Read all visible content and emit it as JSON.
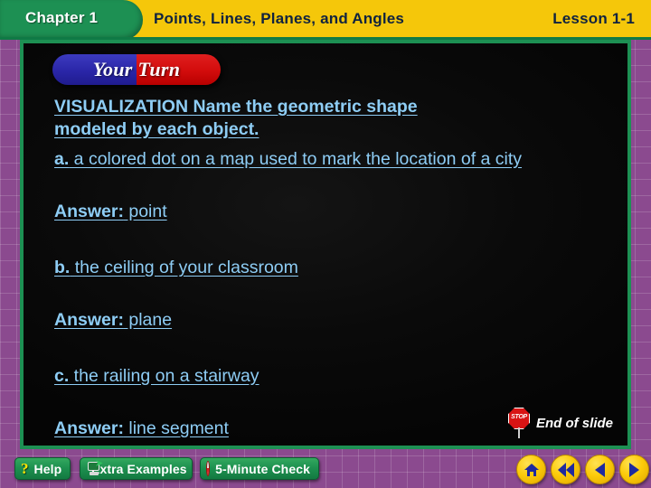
{
  "header": {
    "chapter": "Chapter 1",
    "title": "Points, Lines, Planes, and Angles",
    "lesson": "Lesson 1-1",
    "chapter_tab_color": "#1d9053",
    "bar_color": "#f5c70a",
    "title_text_color": "#10233f"
  },
  "banner": {
    "text": "Your Turn",
    "left_color": "#2a26a8",
    "right_color": "#d20c0c",
    "text_color": "#ffffff"
  },
  "content": {
    "text_color": "#8ecdf5",
    "background_color": "#050505",
    "prompt": {
      "label": "VISUALIZATION",
      "line1": "  Name the geometric shape",
      "line2": "modeled by each object."
    },
    "items": [
      {
        "marker": "a.",
        "question": " a colored dot on a map used to mark the location of a city",
        "answer_label": "Answer:",
        "answer": " point"
      },
      {
        "marker": "b.",
        "question": " the ceiling of your classroom",
        "answer_label": "Answer:",
        "answer": " plane"
      },
      {
        "marker": "c.",
        "question": " the railing on a stairway",
        "answer_label": "Answer:",
        "answer": " line segment"
      }
    ],
    "end_of_slide": {
      "label": "End of slide",
      "sign_text": "STOP",
      "sign_color": "#d81414"
    }
  },
  "footer": {
    "buttons": [
      {
        "label": "Help",
        "icon": "question-mark-icon"
      },
      {
        "label": "Extra Examples",
        "icon": "monitor-icon"
      },
      {
        "label": "5-Minute Check",
        "icon": "clock-icon"
      }
    ],
    "nav": [
      {
        "name": "home",
        "icon": "home-icon"
      },
      {
        "name": "rewind",
        "icon": "double-left-arrow-icon"
      },
      {
        "name": "previous",
        "icon": "left-arrow-icon"
      },
      {
        "name": "next",
        "icon": "right-arrow-icon"
      }
    ],
    "button_color": "#1e9150",
    "nav_color": "#fccb0a"
  }
}
